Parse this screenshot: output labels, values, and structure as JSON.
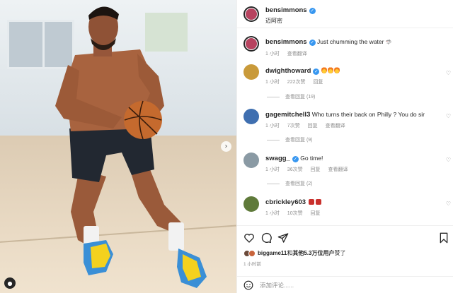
{
  "post": {
    "author": "bensimmons",
    "location": "迈阿密",
    "caption_time": "1 小时",
    "caption_action": "查看翻译",
    "caption": "Just chumming the water",
    "caption_emoji": "🦈"
  },
  "comments": [
    {
      "username": "dwighthoward",
      "text": "",
      "emoji": [
        "🔥",
        "🔥",
        "🔥"
      ],
      "time": "1 小时",
      "likes": "222次赞",
      "reply": "回复",
      "translate": "",
      "view_replies": "查看回复 (19)",
      "avatar_color": "#c99a3a"
    },
    {
      "username": "gagemitchell3",
      "text": "Who turns their back on Philly ? You do sir",
      "emoji": [],
      "time": "1 小时",
      "likes": "7次赞",
      "reply": "回复",
      "translate": "查看翻译",
      "view_replies": "查看回复 (9)",
      "avatar_color": "#3f6fb0"
    },
    {
      "username": "swagg_",
      "text": "Go time!",
      "emoji": [],
      "time": "1 小时",
      "likes": "36次赞",
      "reply": "回复",
      "translate": "查看翻译",
      "view_replies": "查看回复 (2)",
      "avatar_color": "#8a9aa4"
    },
    {
      "username": "cbrickley603",
      "text": "",
      "emoji": [
        "😡",
        "😡"
      ],
      "time": "1 小时",
      "likes": "10次赞",
      "reply": "回复",
      "translate": "",
      "view_replies": "",
      "avatar_color": "#5f7a3a"
    }
  ],
  "likes_line": {
    "user": "biggame11",
    "conjunction": "和",
    "others": "其他5.3万位用户",
    "suffix": "赞了"
  },
  "post_time": "1 小时前",
  "add_comment": {
    "placeholder": "添加评论......"
  },
  "icons": {
    "like": "heart-icon",
    "comment": "comment-bubble-icon",
    "share": "paper-plane-icon",
    "save": "bookmark-icon",
    "emoji": "smiley-icon",
    "next": "chevron-right-icon"
  },
  "colors": {
    "verified": "#3897f0",
    "text": "#262626",
    "muted": "#8e8e8e"
  }
}
